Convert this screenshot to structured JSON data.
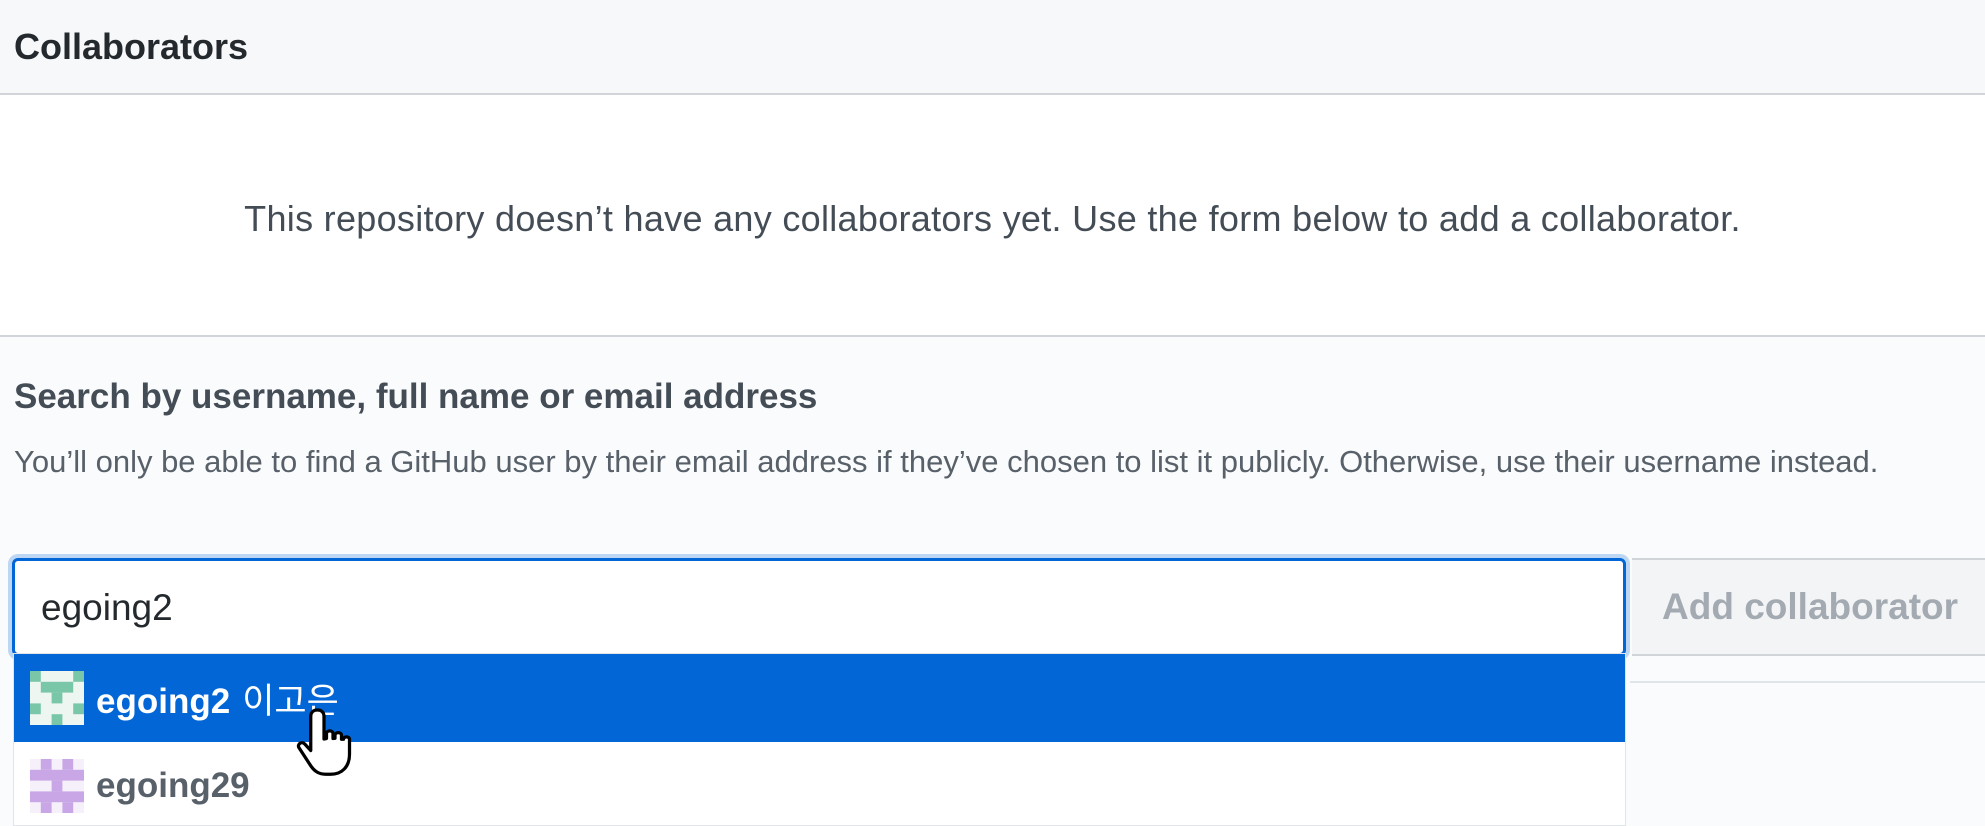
{
  "header": {
    "title": "Collaborators"
  },
  "empty_state": {
    "message": "This repository doesn’t have any collaborators yet. Use the form below to add a collaborator."
  },
  "search": {
    "title": "Search by username, full name or email address",
    "note": "You’ll only be able to find a GitHub user by their email address if they’ve chosen to list it publicly. Otherwise, use their username instead.",
    "input_value": "egoing2",
    "add_button_label": "Add collaborator"
  },
  "suggestions": [
    {
      "username": "egoing2",
      "full_name": "이고은",
      "selected": true,
      "avatar_color": "#79c6a8"
    },
    {
      "username": "egoing29",
      "full_name": "",
      "selected": false,
      "avatar_color": "#c9a7e6"
    }
  ],
  "colors": {
    "accent": "#0366d6",
    "header_bg": "#f6f8fa"
  }
}
